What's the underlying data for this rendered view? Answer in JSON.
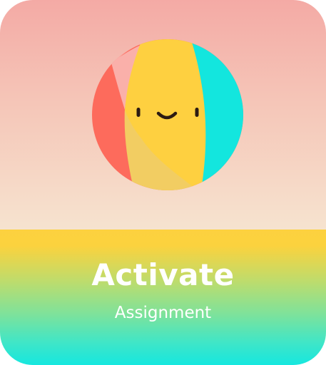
{
  "card": {
    "title": "Activate",
    "subtitle": "Assignment",
    "icon": "smiling-beach-ball-icon",
    "colors": {
      "top_gradient": [
        "#f4aaa5",
        "#f6e3cf"
      ],
      "bottom_gradient": [
        "#fdd13f",
        "#16e7df"
      ],
      "ball_red": "#fd6b5c",
      "ball_pink": "#fab0aa",
      "ball_yellow": "#fed040",
      "ball_cyan": "#13e6de",
      "text": "#ffffff"
    }
  }
}
